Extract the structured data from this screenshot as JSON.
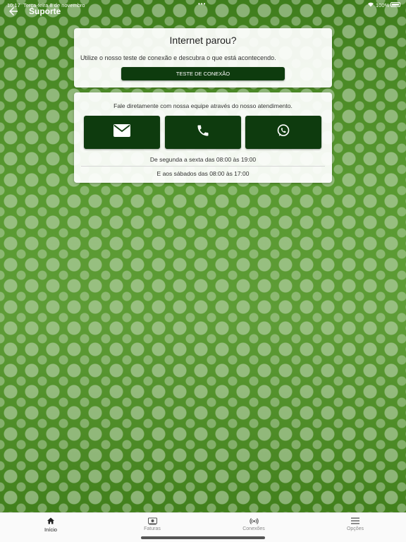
{
  "status_bar": {
    "time": "10:17",
    "date": "Terça-feira 8 de novembro",
    "multitask_dots": "•••",
    "battery_percent": "100%"
  },
  "app_bar": {
    "title": "Suporte",
    "back_icon": "arrow-left-icon"
  },
  "connection_card": {
    "heading": "Internet parou?",
    "description": "Utilize o nosso teste de conexão e descubra o que está acontecendo.",
    "button_label": "TESTE DE CONEXÃO"
  },
  "contact_card": {
    "lead": "Fale diretamente com nossa equipe através do nosso atendimento.",
    "buttons": [
      {
        "icon": "envelope-icon"
      },
      {
        "icon": "phone-icon"
      },
      {
        "icon": "whatsapp-icon"
      }
    ],
    "hours_weekday": "De segunda a sexta das 08:00 às 19:00",
    "hours_saturday": "E aos sábados das 08:00 às 17:00"
  },
  "bottom_nav": {
    "items": [
      {
        "label": "Início",
        "icon": "home-icon",
        "active": true
      },
      {
        "label": "Faturas",
        "icon": "bill-icon",
        "active": false
      },
      {
        "label": "Conexões",
        "icon": "signal-icon",
        "active": false
      },
      {
        "label": "Opções",
        "icon": "menu-icon",
        "active": false
      }
    ]
  },
  "colors": {
    "primary_dark_green": "#0e3b0e",
    "background_green": "#4f8f2a",
    "card_white": "#ffffff"
  }
}
